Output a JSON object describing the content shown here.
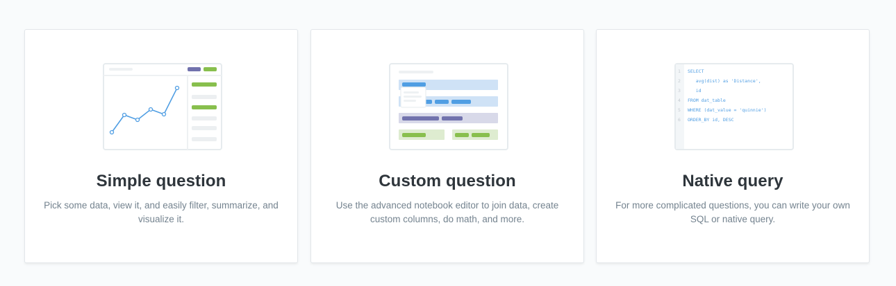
{
  "colors": {
    "background": "#f9fbfc",
    "title": "#2e353b",
    "description": "#74838f",
    "blue": "#509ee3",
    "green": "#88bf4d",
    "purple": "#7172ad"
  },
  "cards": [
    {
      "title": "Simple question",
      "description": "Pick some data, view it, and easily filter, summarize, and visualize it.",
      "illustration": "line-chart-illustration"
    },
    {
      "title": "Custom question",
      "description": "Use the advanced notebook editor to join data, create custom columns, do math, and more.",
      "illustration": "notebook-editor-illustration"
    },
    {
      "title": "Native query",
      "description": "For more complicated questions, you can write your own SQL or native query.",
      "illustration": "sql-editor-illustration",
      "code_lines": [
        {
          "num": "1",
          "text": "SELECT"
        },
        {
          "num": "2",
          "text": "   avg(dist) as 'Distance',"
        },
        {
          "num": "3",
          "text": "   id"
        },
        {
          "num": "4",
          "text": "FROM dat_table"
        },
        {
          "num": "5",
          "text": "WHERE (dat_value = 'quinnie')"
        },
        {
          "num": "6",
          "text": "ORDER_BY id, DESC"
        }
      ]
    }
  ]
}
